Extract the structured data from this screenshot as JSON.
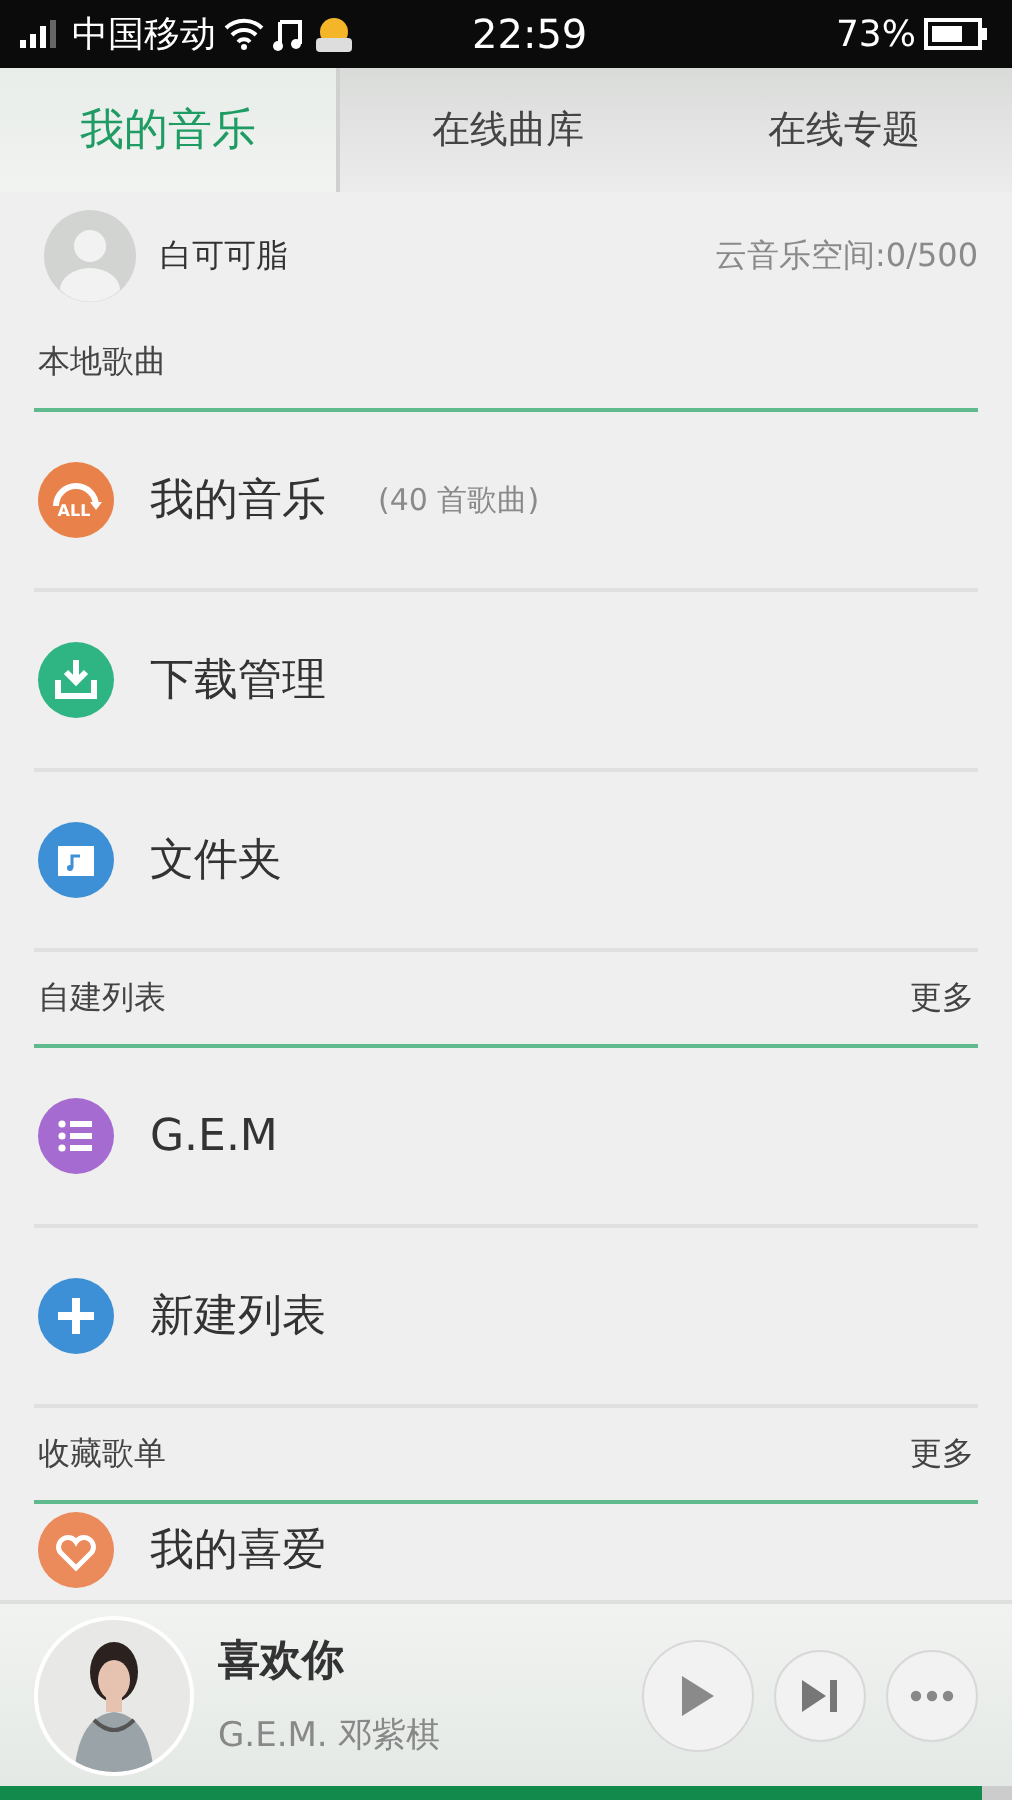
{
  "status_bar": {
    "carrier": "中国移动",
    "time": "22:59",
    "battery": "73%"
  },
  "tabs": [
    {
      "label": "我的音乐",
      "selected": true
    },
    {
      "label": "在线曲库",
      "selected": false
    },
    {
      "label": "在线专题",
      "selected": false
    }
  ],
  "user": {
    "name": "白可可脂",
    "cloud_space": "云音乐空间:0/500"
  },
  "sections": [
    {
      "title": "本地歌曲",
      "items": [
        {
          "kind": "all",
          "label": "我的音乐",
          "count": "(40 首歌曲)",
          "icon_text": "ALL"
        },
        {
          "kind": "download",
          "label": "下载管理"
        },
        {
          "kind": "folder",
          "label": "文件夹"
        }
      ]
    },
    {
      "title": "自建列表",
      "more": "更多",
      "items": [
        {
          "kind": "list",
          "label": "G.E.M"
        },
        {
          "kind": "add",
          "label": "新建列表"
        }
      ]
    },
    {
      "title": "收藏歌单",
      "more": "更多",
      "items": [
        {
          "kind": "heart",
          "label": "我的喜爱"
        }
      ]
    }
  ],
  "player": {
    "title": "喜欢你",
    "artist": "G.E.M. 邓紫棋",
    "progress": {
      "level": 0.97
    }
  }
}
